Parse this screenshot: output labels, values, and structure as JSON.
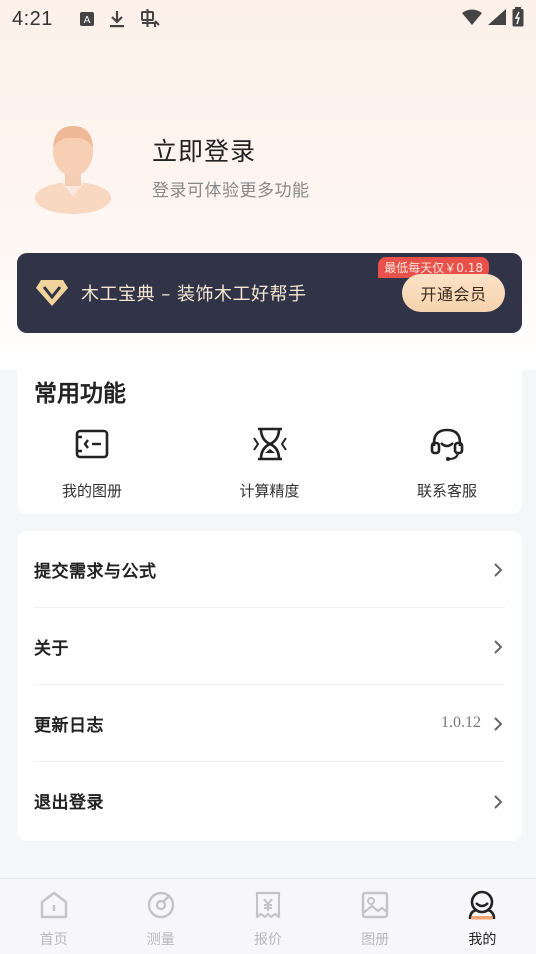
{
  "status_bar": {
    "time": "4:21",
    "icons": [
      "font-a-icon",
      "download-icon",
      "bug-icon"
    ],
    "right_icons": [
      "wifi-icon",
      "signal-icon",
      "battery-icon"
    ]
  },
  "profile": {
    "title": "立即登录",
    "subtitle": "登录可体验更多功能"
  },
  "vip": {
    "text": "木工宝典 – 装饰木工好帮手",
    "tag": "最低每天仅￥0.18",
    "button": "开通会员",
    "colors": {
      "banner": "#313446",
      "button": "#f6d2ad",
      "tag": "#e8504a"
    }
  },
  "functions": {
    "title": "常用功能",
    "items": [
      {
        "label": "我的图册",
        "icon": "album-icon"
      },
      {
        "label": "计算精度",
        "icon": "hourglass-icon"
      },
      {
        "label": "联系客服",
        "icon": "headset-icon"
      }
    ]
  },
  "menu": [
    {
      "label": "提交需求与公式",
      "value": ""
    },
    {
      "label": "关于",
      "value": ""
    },
    {
      "label": "更新日志",
      "value": "1.0.12"
    },
    {
      "label": "退出登录",
      "value": ""
    }
  ],
  "tabs": [
    {
      "label": "首页",
      "icon": "home-icon",
      "active": false
    },
    {
      "label": "测量",
      "icon": "measure-icon",
      "active": false
    },
    {
      "label": "报价",
      "icon": "quote-icon",
      "active": false
    },
    {
      "label": "图册",
      "icon": "gallery-icon",
      "active": false
    },
    {
      "label": "我的",
      "icon": "profile-icon",
      "active": true
    }
  ]
}
